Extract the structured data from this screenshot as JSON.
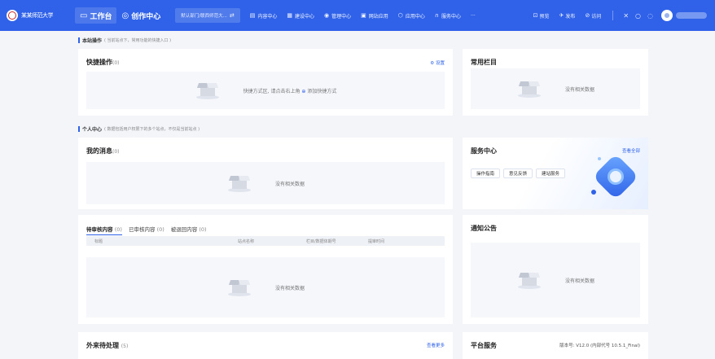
{
  "header": {
    "logo_text": "某某师范大学",
    "workbench": "工作台",
    "creation_center": "创作中心",
    "site_selector": "默认部门/联西师范大...",
    "nav_items": [
      {
        "label": "内容中心",
        "icon": "document-icon"
      },
      {
        "label": "建设中心",
        "icon": "build-icon"
      },
      {
        "label": "管理中心",
        "icon": "manage-icon"
      },
      {
        "label": "网站应用",
        "icon": "web-app-icon"
      },
      {
        "label": "应用中心",
        "icon": "app-center-icon"
      },
      {
        "label": "服务中心",
        "icon": "headset-icon"
      }
    ],
    "more": "···",
    "right_actions": [
      {
        "label": "预览",
        "icon": "preview-icon"
      },
      {
        "label": "发布",
        "icon": "publish-icon"
      },
      {
        "label": "访问",
        "icon": "visit-icon"
      }
    ]
  },
  "site_ops": {
    "heading": "本站操作",
    "desc": "( 当前站点下，常用功能的快捷入口 )"
  },
  "quick_ops": {
    "title": "快捷操作",
    "count": "(0)",
    "settings": "设置",
    "empty_prefix": "快捷方式区, 请点击右上角",
    "empty_action": "添加快捷方式"
  },
  "common_columns": {
    "title": "常用栏目",
    "empty": "没有相关数据"
  },
  "personal": {
    "heading": "个人中心",
    "desc": "( 数据包括用户权限下的多个站点，不仅是当前站点 )"
  },
  "messages": {
    "title": "我的消息",
    "count": "(0)",
    "empty": "没有相关数据"
  },
  "service_center": {
    "title": "服务中心",
    "view_all": "查看全部",
    "buttons": [
      "操作指南",
      "意见反馈",
      "建站服务"
    ]
  },
  "review": {
    "tabs": [
      {
        "label": "待审核内容",
        "count": "(0)"
      },
      {
        "label": "已审核内容",
        "count": "(0)"
      },
      {
        "label": "被退回内容",
        "count": "(0)"
      }
    ],
    "columns": [
      "标题",
      "站点名称",
      "栏目/数据体期号",
      "提审时间"
    ],
    "empty": "没有相关数据"
  },
  "notices": {
    "title": "通知公告",
    "empty": "没有相关数据"
  },
  "external": {
    "title": "外来待处理",
    "count": "(5)",
    "more": "查看更多"
  },
  "platform": {
    "title": "平台服务",
    "version": "版本号: V12.0 (内部代号 10.5.1_Final)"
  },
  "colors": {
    "brand": "#2f62e8",
    "page_bg": "#f3f5f9"
  }
}
